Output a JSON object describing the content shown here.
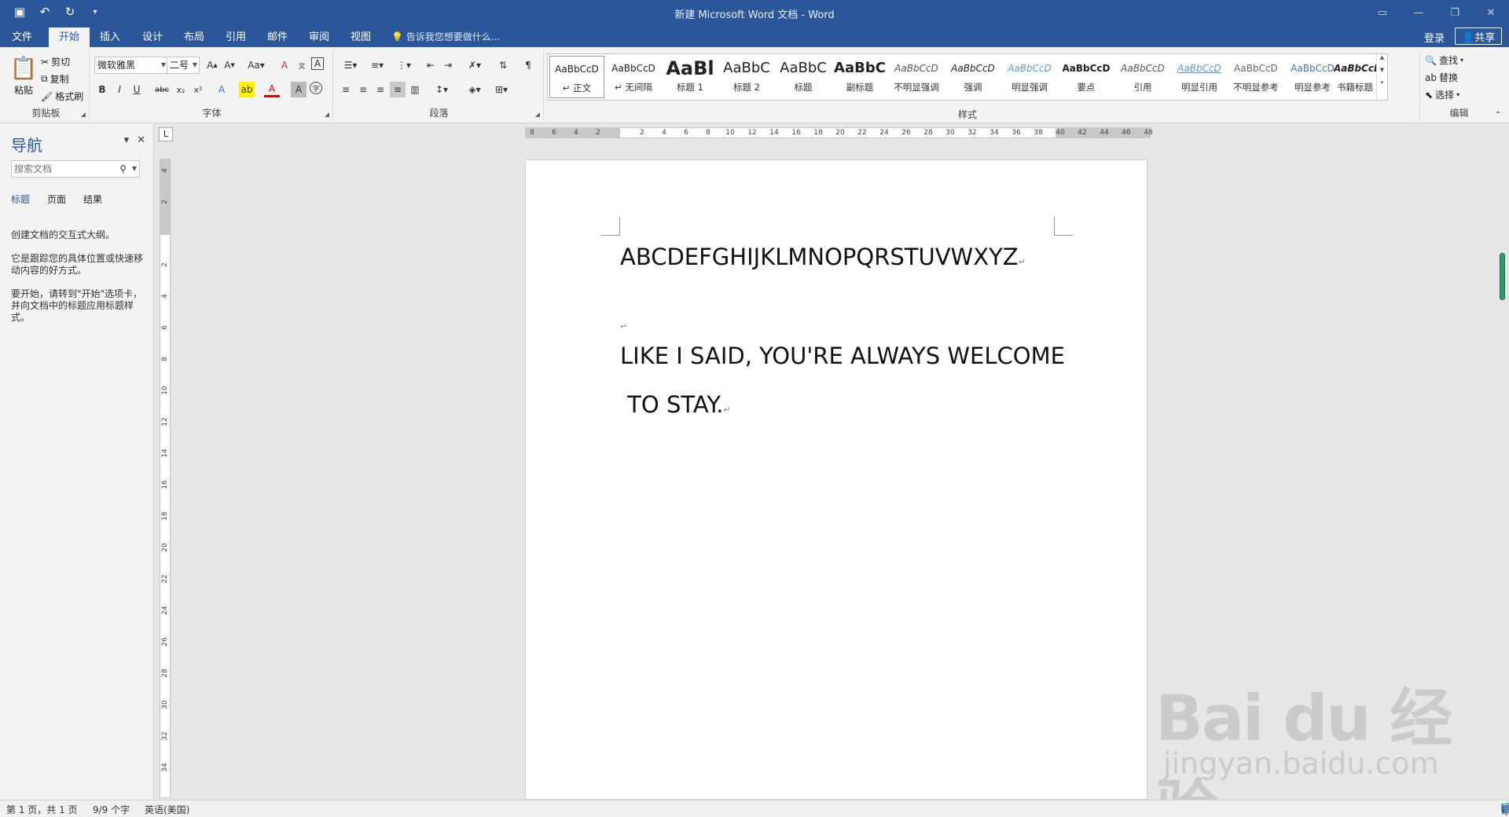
{
  "window": {
    "title": "新建 Microsoft Word 文档 - Word"
  },
  "tabs": [
    "文件",
    "开始",
    "插入",
    "设计",
    "布局",
    "引用",
    "邮件",
    "审阅",
    "视图"
  ],
  "tell_me": "告诉我您想要做什么...",
  "account": {
    "login": "登录",
    "share": "共享"
  },
  "clipboard": {
    "paste": "粘贴",
    "cut": "剪切",
    "copy": "复制",
    "format_painter": "格式刷",
    "label": "剪贴板"
  },
  "font": {
    "name": "微软雅黑",
    "size": "二号",
    "label": "字体"
  },
  "paragraph": {
    "label": "段落"
  },
  "styles": {
    "label": "样式",
    "items": [
      {
        "preview": "AaBbCcD",
        "name": "↵ 正文"
      },
      {
        "preview": "AaBbCcD",
        "name": "↵ 无间隔"
      },
      {
        "preview": "AaBl",
        "name": "标题 1"
      },
      {
        "preview": "AaBbC",
        "name": "标题 2"
      },
      {
        "preview": "AaBbC",
        "name": "标题"
      },
      {
        "preview": "AaBbC",
        "name": "副标题"
      },
      {
        "preview": "AaBbCcD",
        "name": "不明显强调"
      },
      {
        "preview": "AaBbCcD",
        "name": "强调"
      },
      {
        "preview": "AaBbCcD",
        "name": "明显强调"
      },
      {
        "preview": "AaBbCcD",
        "name": "要点"
      },
      {
        "preview": "AaBbCcD",
        "name": "引用"
      },
      {
        "preview": "AaBbCcD",
        "name": "明显引用"
      },
      {
        "preview": "AaBbCcD",
        "name": "不明显参考"
      },
      {
        "preview": "AaBbCcD",
        "name": "明显参考"
      },
      {
        "preview": "AaBbCcD",
        "name": "书籍标题"
      }
    ]
  },
  "editing": {
    "find": "查找",
    "replace": "替换",
    "select": "选择",
    "label": "编辑"
  },
  "nav": {
    "title": "导航",
    "search_placeholder": "搜索文档",
    "tabs": [
      "标题",
      "页面",
      "结果"
    ],
    "text": [
      "创建文档的交互式大纲。",
      "它是跟踪您的具体位置或快速移动内容的好方式。",
      "要开始，请转到\"开始\"选项卡，并向文档中的标题应用标题样式。"
    ]
  },
  "ruler": {
    "h_labels": [
      "8",
      "6",
      "4",
      "2",
      "",
      "2",
      "4",
      "6",
      "8",
      "10",
      "12",
      "14",
      "16",
      "18",
      "20",
      "22",
      "24",
      "26",
      "28",
      "30",
      "32",
      "34",
      "36",
      "38",
      "40",
      "42",
      "44",
      "46",
      "48"
    ],
    "v_labels": [
      "4",
      "2",
      "",
      "2",
      "4",
      "6",
      "8",
      "10",
      "12",
      "14",
      "16",
      "18",
      "20",
      "22",
      "24",
      "26",
      "28",
      "30",
      "32",
      "34"
    ],
    "corner": "L"
  },
  "document": {
    "line1": "ABCDEFGHIJKLMNOPQRSTUVWXYZ",
    "line2": "LIKE I SAID, YOU'RE ALWAYS WELCOME",
    "line3": " TO STAY.",
    "para_mark": "↵"
  },
  "status": {
    "page": "第 1 页，共 1 页",
    "words": "9/9 个字",
    "language": "英语(美国)"
  },
  "watermark": {
    "brand": "Bai du 经验",
    "url": "jingyan.baidu.com"
  }
}
